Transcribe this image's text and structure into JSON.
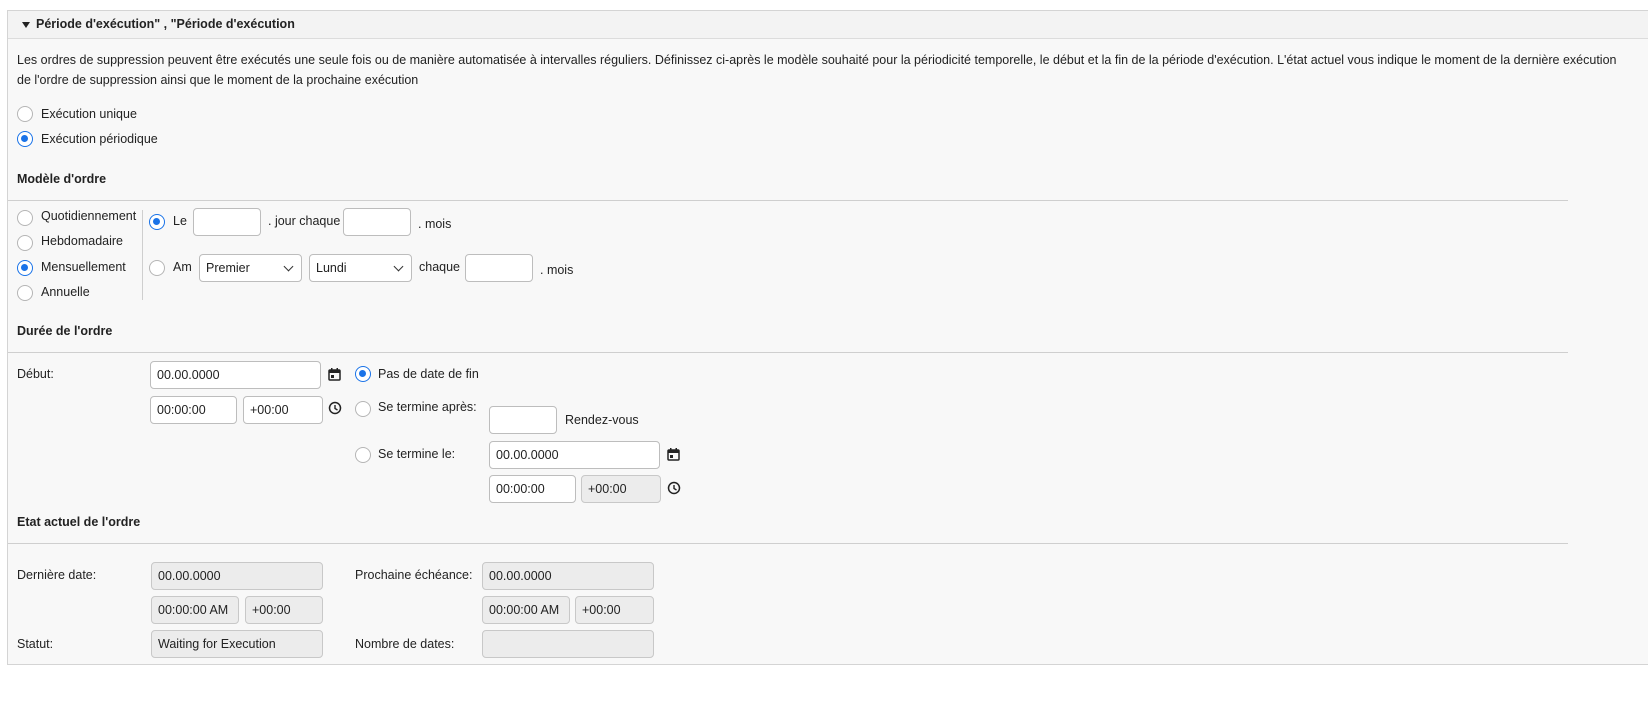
{
  "header": {
    "title": "Période d'exécution\" , \"Période d'exécution"
  },
  "description": {
    "line1": "Les ordres de suppression peuvent être exécutés une seule fois ou de manière automatisée à intervalles réguliers. Définissez ci-après le modèle souhaité pour la périodicité temporelle, le début et la fin de la période d'exécution. L'état actuel vous indique le moment de la dernière exécution",
    "line2": "de l'ordre de suppression ainsi que le moment de la prochaine exécution"
  },
  "execution": {
    "unique_label": "Exécution unique",
    "periodic_label": "Exécution périodique",
    "selected": "periodic"
  },
  "model": {
    "title": "Modèle d'ordre",
    "options": [
      "Quotidiennement",
      "Hebdomadaire",
      "Mensuellement",
      "Annuelle"
    ],
    "selected": "Mensuellement",
    "row1": {
      "prefix": "Le",
      "day_value": "",
      "middle": ". jour chaque",
      "month_value": "",
      "suffix": ". mois"
    },
    "row2": {
      "prefix": "Am",
      "ordinal_value": "Premier",
      "weekday_value": "Lundi",
      "middle": "chaque",
      "month_value": "",
      "suffix": ". mois"
    }
  },
  "duration": {
    "title": "Durée de l'ordre",
    "start_label": "Début:",
    "start_date": "00.00.0000",
    "start_time": "00:00:00",
    "start_tz": "+00:00",
    "no_end_label": "Pas de date de fin",
    "ends_after_label": "Se termine après:",
    "ends_after_value": "",
    "appointments_label": "Rendez-vous",
    "ends_on_label": "Se termine le:",
    "end_date": "00.00.0000",
    "end_time": "00:00:00",
    "end_tz": "+00:00"
  },
  "status": {
    "title": "Etat actuel de l'ordre",
    "last_date_label": "Dernière date:",
    "last_date": "00.00.0000",
    "last_time": "00:00:00 AM",
    "last_tz": "+00:00",
    "next_label": "Prochaine échéance:",
    "next_date": "00.00.0000",
    "next_time": "00:00:00 AM",
    "next_tz": "+00:00",
    "status_label": "Statut:",
    "status_value": "Waiting for Execution",
    "count_label": "Nombre de dates:",
    "count_value": ""
  },
  "colors": {
    "accent": "#1a73e8",
    "panel_bg": "#f8f8f8",
    "readonly_bg": "#ececec"
  }
}
